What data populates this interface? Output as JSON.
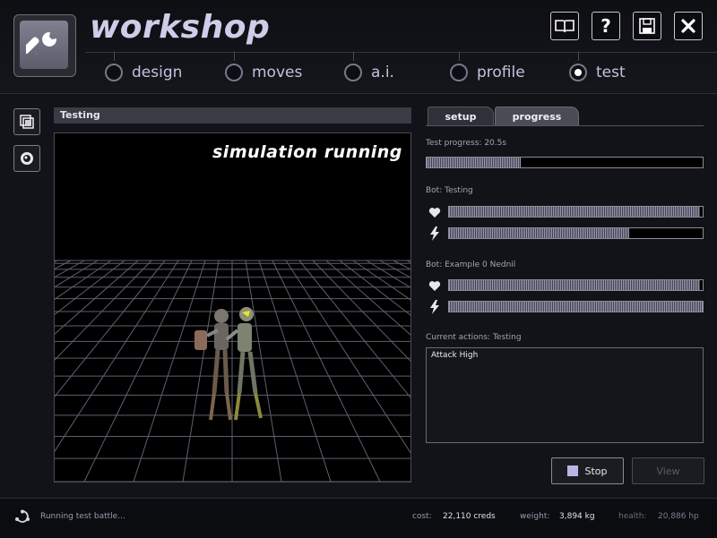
{
  "app": {
    "title": "workshop"
  },
  "header_buttons": [
    {
      "name": "manual",
      "icon": "book-icon"
    },
    {
      "name": "help",
      "label": "?",
      "icon": "help-icon"
    },
    {
      "name": "save",
      "icon": "floppy-disk-icon"
    },
    {
      "name": "close",
      "icon": "close-icon"
    }
  ],
  "nav": {
    "tabs": [
      {
        "label": "design",
        "selected": false
      },
      {
        "label": "moves",
        "selected": false
      },
      {
        "label": "a.i.",
        "selected": false
      },
      {
        "label": "profile",
        "selected": false
      },
      {
        "label": "test",
        "selected": true
      }
    ]
  },
  "tools": [
    {
      "icon": "cube-view-icon"
    },
    {
      "icon": "camera-lens-icon"
    }
  ],
  "viewport": {
    "title": "Testing",
    "overlay_text": "simulation running"
  },
  "progress_panel": {
    "tabs": [
      {
        "label": "setup",
        "selected": false
      },
      {
        "label": "progress",
        "selected": true
      }
    ],
    "test_progress": {
      "label": "Test progress: 20.5s",
      "fraction": 0.34
    },
    "bots": [
      {
        "label": "Bot: Testing",
        "health_fraction": 0.99,
        "energy_fraction": 0.71
      },
      {
        "label": "Bot: Example 0 Nednil",
        "health_fraction": 0.99,
        "energy_fraction": 1.0
      }
    ],
    "actions": {
      "label": "Current actions: Testing",
      "items": [
        "Attack High"
      ]
    },
    "buttons": {
      "stop": "Stop",
      "view": "View"
    }
  },
  "status": {
    "message": "Running test battle...",
    "cost_label": "cost:",
    "cost_value": "22,110 creds",
    "weight_label": "weight:",
    "weight_value": "3,894 kg",
    "health_label": "health:",
    "health_value": "20,886 hp"
  },
  "colors": {
    "accent": "#c4c2dd",
    "bar_fill": "#9a9bb1",
    "background": "#111318"
  }
}
